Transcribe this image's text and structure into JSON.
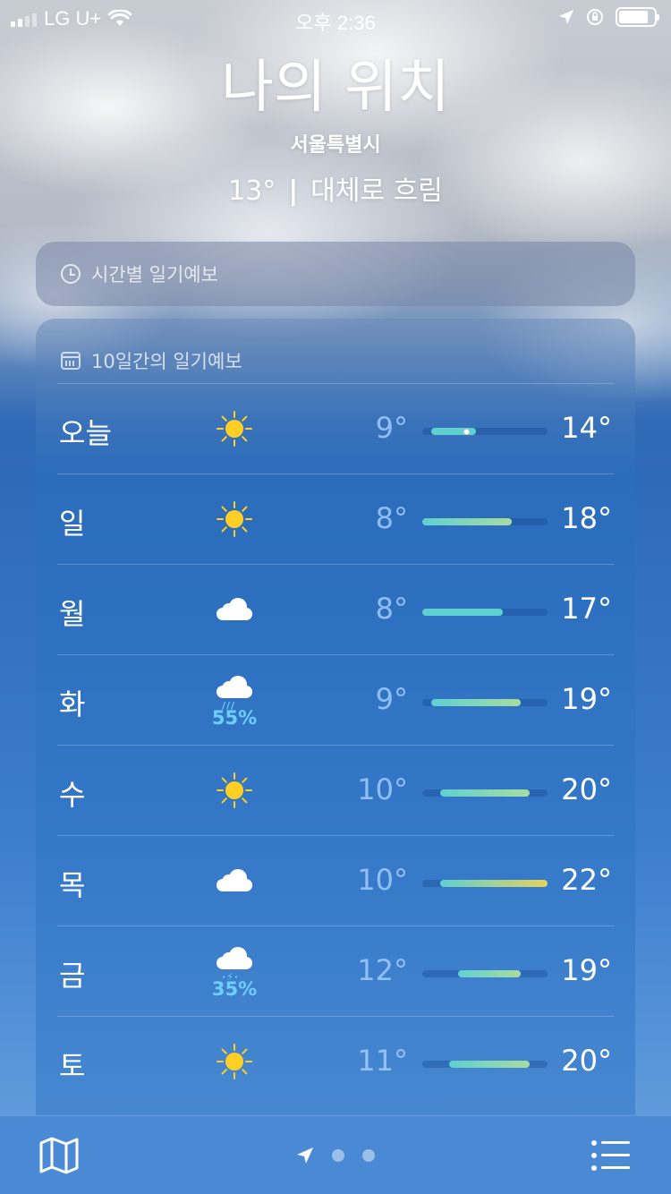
{
  "status_bar": {
    "carrier": "LG U+",
    "time": "오후 2:36"
  },
  "header": {
    "title": "나의 위치",
    "subtitle": "서울특별시",
    "temperature": "13°",
    "separator": "|",
    "condition": "대체로 흐림"
  },
  "hourly": {
    "label": "시간별 일기예보",
    "icon": "clock-icon"
  },
  "daily": {
    "label": "10일간의 일기예보",
    "icon": "calendar-icon",
    "scale": {
      "min": 8,
      "max": 22
    },
    "colors": {
      "cool": "#5fd0d0",
      "mild": "#a8dca0",
      "warm": "#e6d25a"
    },
    "days": [
      {
        "day": "오늘",
        "icon": "sun-icon",
        "precip": "",
        "low": "9°",
        "high": "14°",
        "low_val": 9,
        "high_val": 14,
        "current": 13
      },
      {
        "day": "일",
        "icon": "sun-icon",
        "precip": "",
        "low": "8°",
        "high": "18°",
        "low_val": 8,
        "high_val": 18
      },
      {
        "day": "월",
        "icon": "cloud-icon",
        "precip": "",
        "low": "8°",
        "high": "17°",
        "low_val": 8,
        "high_val": 17
      },
      {
        "day": "화",
        "icon": "rain-cloud-icon",
        "precip": "55%",
        "low": "9°",
        "high": "19°",
        "low_val": 9,
        "high_val": 19
      },
      {
        "day": "수",
        "icon": "sun-icon",
        "precip": "",
        "low": "10°",
        "high": "20°",
        "low_val": 10,
        "high_val": 20
      },
      {
        "day": "목",
        "icon": "cloud-icon",
        "precip": "",
        "low": "10°",
        "high": "22°",
        "low_val": 10,
        "high_val": 22
      },
      {
        "day": "금",
        "icon": "thunderstorm-icon",
        "precip": "35%",
        "low": "12°",
        "high": "19°",
        "low_val": 12,
        "high_val": 19
      },
      {
        "day": "토",
        "icon": "sun-icon",
        "precip": "",
        "low": "11°",
        "high": "20°",
        "low_val": 11,
        "high_val": 20
      }
    ]
  },
  "toolbar": {
    "map_icon": "map-icon",
    "location_icon": "location-arrow-icon",
    "pages": 2,
    "list_icon": "list-icon"
  }
}
